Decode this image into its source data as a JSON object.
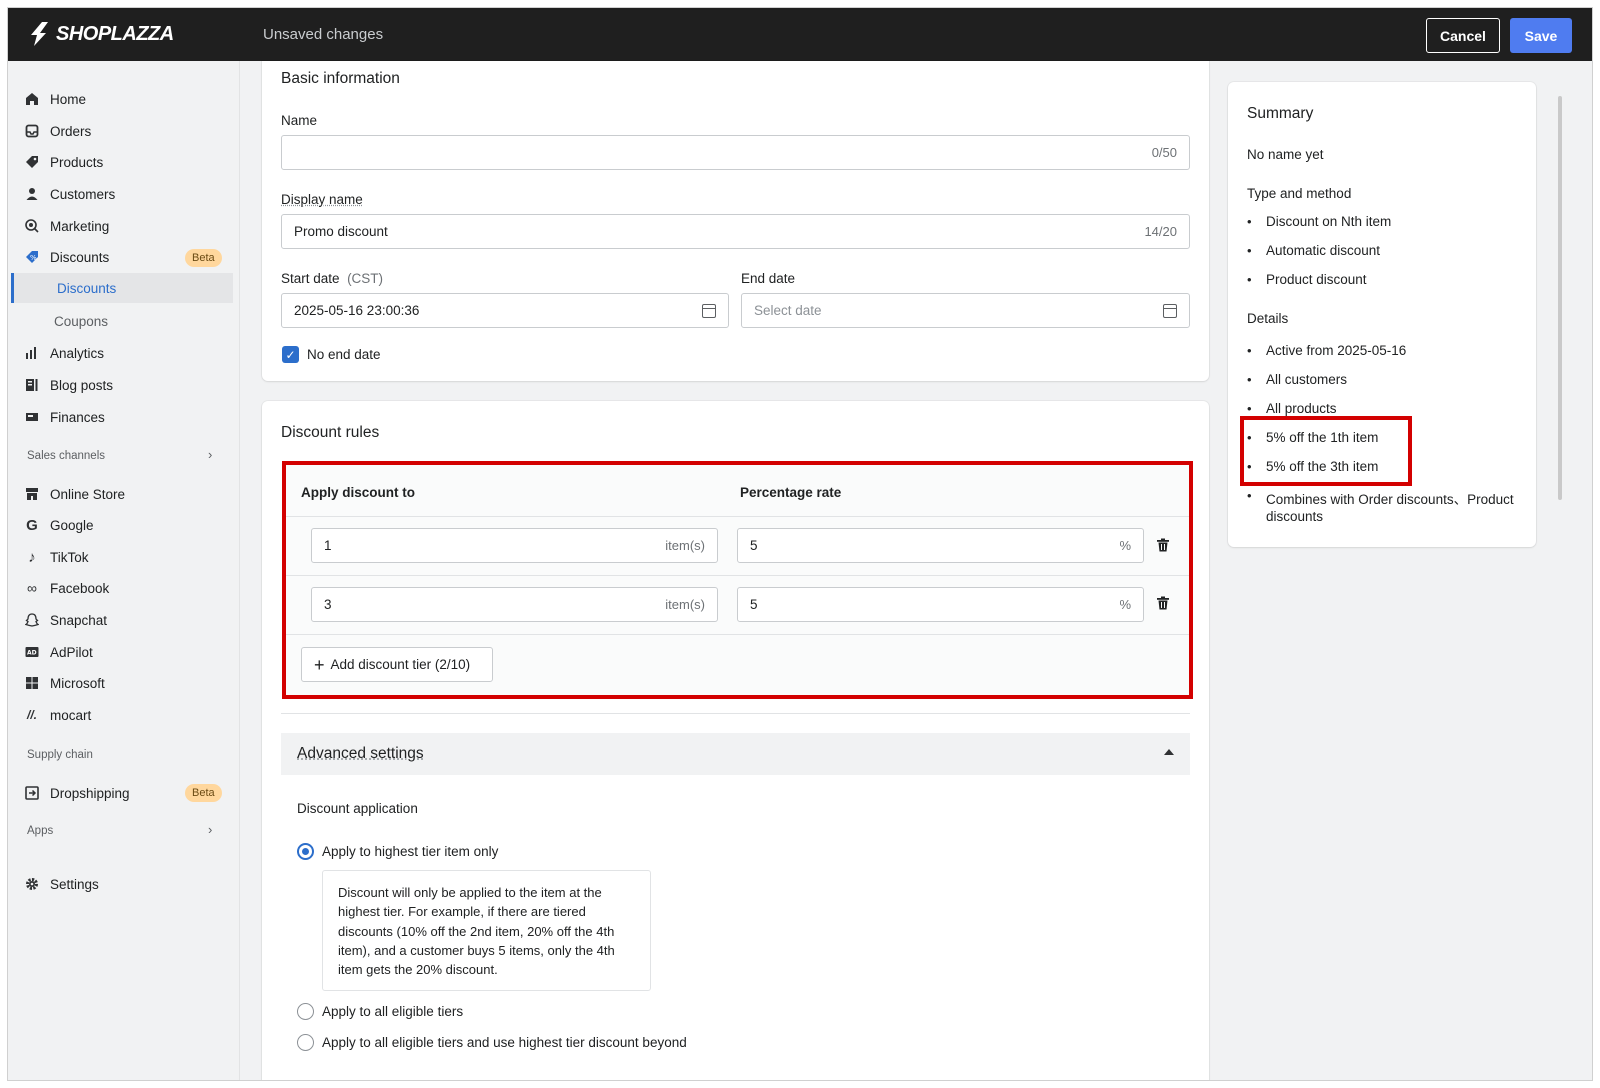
{
  "topbar": {
    "logo_text": "SHOPLAZZA",
    "status": "Unsaved changes",
    "cancel_label": "Cancel",
    "save_label": "Save"
  },
  "sidebar": {
    "items": [
      {
        "label": "Home",
        "icon": "home-icon"
      },
      {
        "label": "Orders",
        "icon": "orders-icon"
      },
      {
        "label": "Products",
        "icon": "tag-icon"
      },
      {
        "label": "Customers",
        "icon": "person-icon"
      },
      {
        "label": "Marketing",
        "icon": "target-icon"
      },
      {
        "label": "Discounts",
        "icon": "discount-icon",
        "badge": "Beta"
      },
      {
        "label": "Discounts",
        "sub": true,
        "active": true
      },
      {
        "label": "Coupons",
        "sub": true
      },
      {
        "label": "Analytics",
        "icon": "bar-chart-icon"
      },
      {
        "label": "Blog posts",
        "icon": "blog-icon"
      },
      {
        "label": "Finances",
        "icon": "finance-icon"
      }
    ],
    "sales_channels_label": "Sales channels",
    "channels": [
      {
        "label": "Online Store",
        "icon": "store-icon"
      },
      {
        "label": "Google",
        "icon": "google-icon"
      },
      {
        "label": "TikTok",
        "icon": "tiktok-icon"
      },
      {
        "label": "Facebook",
        "icon": "meta-icon"
      },
      {
        "label": "Snapchat",
        "icon": "snapchat-icon"
      },
      {
        "label": "AdPilot",
        "icon": "ad-icon"
      },
      {
        "label": "Microsoft",
        "icon": "microsoft-icon"
      },
      {
        "label": "mocart",
        "icon": "mocart-icon"
      }
    ],
    "supply_chain_label": "Supply chain",
    "dropshipping": {
      "label": "Dropshipping",
      "badge": "Beta",
      "icon": "dropshipping-icon"
    },
    "apps_label": "Apps",
    "settings_label": "Settings"
  },
  "basic_info": {
    "title": "Basic information",
    "name_label": "Name",
    "name_value": "",
    "name_counter": "0/50",
    "display_name_label": "Display name",
    "display_name_value": "Promo discount",
    "display_name_counter": "14/20",
    "start_date_label": "Start date",
    "start_date_tz": "(CST)",
    "start_date_value": "2025-05-16 23:00:36",
    "end_date_label": "End date",
    "end_date_placeholder": "Select date",
    "no_end_date_label": "No end date",
    "no_end_date_checked": true
  },
  "discount_rules": {
    "title": "Discount rules",
    "col_apply": "Apply discount to",
    "col_rate": "Percentage rate",
    "tiers": [
      {
        "items": "1",
        "items_suffix": "item(s)",
        "rate": "5",
        "rate_suffix": "%"
      },
      {
        "items": "3",
        "items_suffix": "item(s)",
        "rate": "5",
        "rate_suffix": "%"
      }
    ],
    "add_tier_label": "Add discount tier (2/10)"
  },
  "advanced": {
    "title": "Advanced settings",
    "discount_application_label": "Discount application",
    "options": [
      {
        "label": "Apply to highest tier item only",
        "selected": true
      },
      {
        "label": "Apply to all eligible tiers",
        "selected": false
      },
      {
        "label": "Apply to all eligible tiers and use highest tier discount beyond",
        "selected": false
      }
    ],
    "help_text": "Discount will only be applied to the item at the highest tier. For example, if there are tiered discounts (10% off the 2nd item, 20% off the 4th item), and a customer buys 5 items, only the 4th item gets the 20% discount."
  },
  "summary": {
    "title": "Summary",
    "name_text": "No name yet",
    "type_heading": "Type and method",
    "type_items": [
      "Discount on Nth item",
      "Automatic discount",
      "Product discount"
    ],
    "details_heading": "Details",
    "details_items": [
      "Active from 2025-05-16",
      "All customers",
      "All products",
      "5% off the 1th item",
      "5% off the 3th item"
    ],
    "combines_line1": "Combines with Order discounts、Product",
    "combines_line2": "discounts"
  },
  "colors": {
    "accent": "#2c6ecb",
    "save": "#4f7cf0",
    "highlight": "#d30000",
    "badge": "#ffd79d"
  }
}
